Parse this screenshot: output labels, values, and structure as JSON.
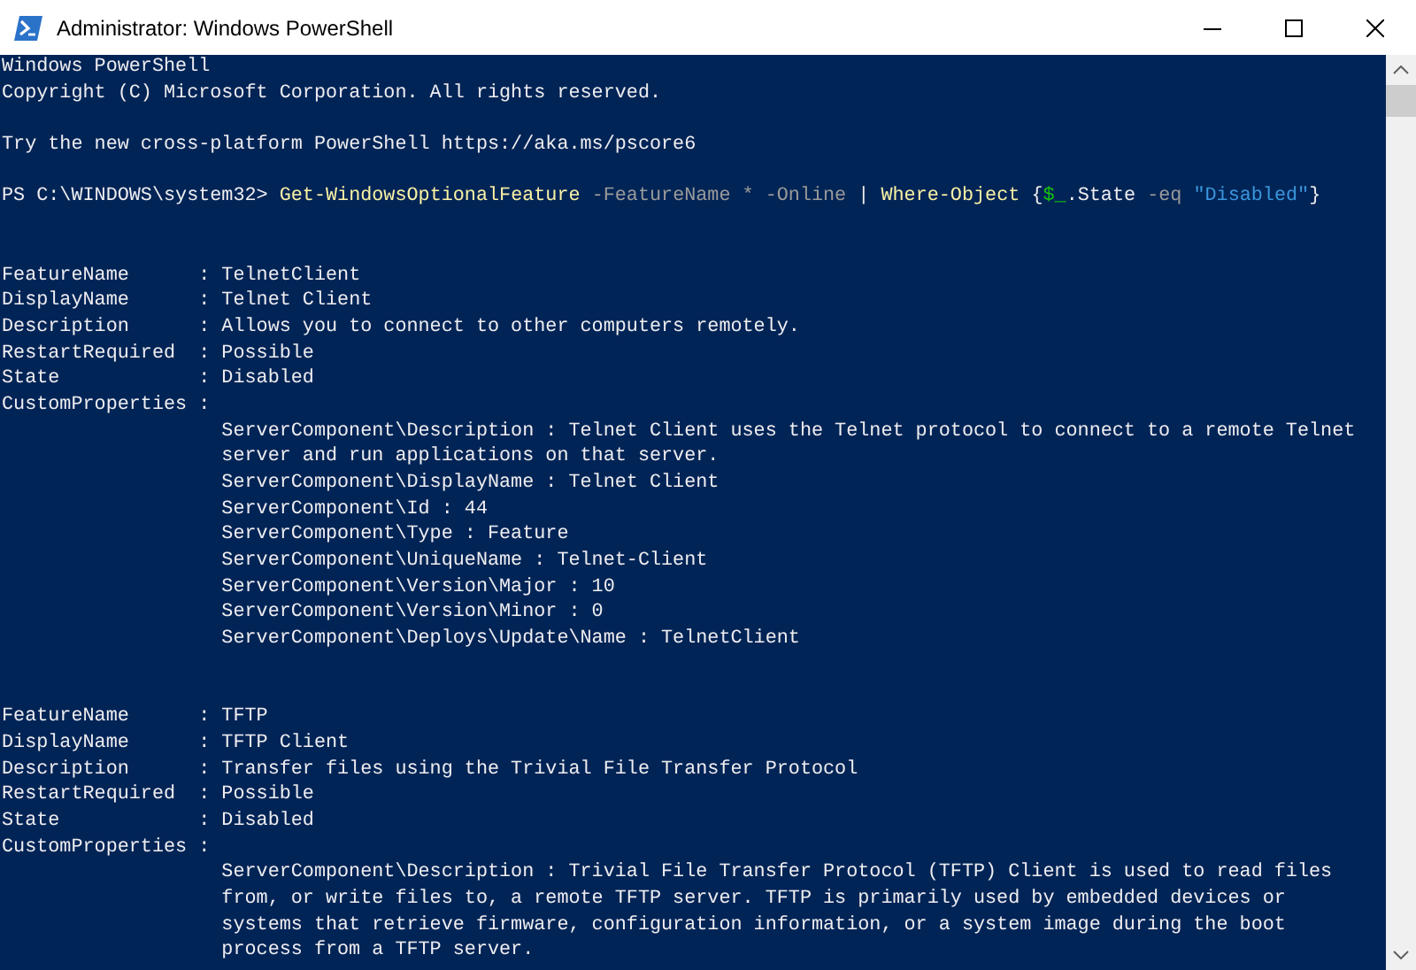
{
  "window": {
    "title": "Administrator: Windows PowerShell"
  },
  "console": {
    "lines": [
      {
        "kind": "output",
        "indent": false,
        "segments": [
          {
            "kind": "text",
            "text": "Windows PowerShell"
          }
        ]
      },
      {
        "kind": "output",
        "indent": false,
        "segments": [
          {
            "kind": "text",
            "text": "Copyright (C) Microsoft Corporation. All rights reserved."
          }
        ]
      },
      {
        "kind": "blank"
      },
      {
        "kind": "output",
        "indent": false,
        "segments": [
          {
            "kind": "text",
            "text": "Try the new cross-platform PowerShell https://aka.ms/pscore6"
          }
        ]
      },
      {
        "kind": "blank"
      },
      {
        "kind": "output",
        "indent": false,
        "segments": [
          {
            "kind": "text",
            "text": "PS C:\\WINDOWS\\system32> "
          },
          {
            "kind": "command",
            "text": "Get-WindowsOptionalFeature"
          },
          {
            "kind": "param",
            "text": " -FeatureName * -Online "
          },
          {
            "kind": "text",
            "text": "| "
          },
          {
            "kind": "command",
            "text": "Where-Object"
          },
          {
            "kind": "text",
            "text": " {"
          },
          {
            "kind": "variable",
            "text": "$_"
          },
          {
            "kind": "text",
            "text": ".State "
          },
          {
            "kind": "param",
            "text": "-eq "
          },
          {
            "kind": "string",
            "text": "\"Disabled\""
          },
          {
            "kind": "text",
            "text": "}"
          }
        ]
      },
      {
        "kind": "blank"
      },
      {
        "kind": "blank"
      },
      {
        "kind": "output",
        "indent": false,
        "segments": [
          {
            "kind": "text",
            "text": "FeatureName      : TelnetClient"
          }
        ]
      },
      {
        "kind": "output",
        "indent": false,
        "segments": [
          {
            "kind": "text",
            "text": "DisplayName      : Telnet Client"
          }
        ]
      },
      {
        "kind": "output",
        "indent": false,
        "segments": [
          {
            "kind": "text",
            "text": "Description      : Allows you to connect to other computers remotely."
          }
        ]
      },
      {
        "kind": "output",
        "indent": false,
        "segments": [
          {
            "kind": "text",
            "text": "RestartRequired  : Possible"
          }
        ]
      },
      {
        "kind": "output",
        "indent": false,
        "segments": [
          {
            "kind": "text",
            "text": "State            : Disabled"
          }
        ]
      },
      {
        "kind": "output",
        "indent": false,
        "segments": [
          {
            "kind": "text",
            "text": "CustomProperties :"
          }
        ]
      },
      {
        "kind": "output",
        "indent": true,
        "segments": [
          {
            "kind": "text",
            "text": "ServerComponent\\Description : Telnet Client uses the Telnet protocol to connect to a remote Telnet"
          }
        ]
      },
      {
        "kind": "output",
        "indent": true,
        "segments": [
          {
            "kind": "text",
            "text": "server and run applications on that server."
          }
        ]
      },
      {
        "kind": "output",
        "indent": true,
        "segments": [
          {
            "kind": "text",
            "text": "ServerComponent\\DisplayName : Telnet Client"
          }
        ]
      },
      {
        "kind": "output",
        "indent": true,
        "segments": [
          {
            "kind": "text",
            "text": "ServerComponent\\Id : 44"
          }
        ]
      },
      {
        "kind": "output",
        "indent": true,
        "segments": [
          {
            "kind": "text",
            "text": "ServerComponent\\Type : Feature"
          }
        ]
      },
      {
        "kind": "output",
        "indent": true,
        "segments": [
          {
            "kind": "text",
            "text": "ServerComponent\\UniqueName : Telnet-Client"
          }
        ]
      },
      {
        "kind": "output",
        "indent": true,
        "segments": [
          {
            "kind": "text",
            "text": "ServerComponent\\Version\\Major : 10"
          }
        ]
      },
      {
        "kind": "output",
        "indent": true,
        "segments": [
          {
            "kind": "text",
            "text": "ServerComponent\\Version\\Minor : 0"
          }
        ]
      },
      {
        "kind": "output",
        "indent": true,
        "segments": [
          {
            "kind": "text",
            "text": "ServerComponent\\Deploys\\Update\\Name : TelnetClient"
          }
        ]
      },
      {
        "kind": "blank"
      },
      {
        "kind": "blank"
      },
      {
        "kind": "output",
        "indent": false,
        "segments": [
          {
            "kind": "text",
            "text": "FeatureName      : TFTP"
          }
        ]
      },
      {
        "kind": "output",
        "indent": false,
        "segments": [
          {
            "kind": "text",
            "text": "DisplayName      : TFTP Client"
          }
        ]
      },
      {
        "kind": "output",
        "indent": false,
        "segments": [
          {
            "kind": "text",
            "text": "Description      : Transfer files using the Trivial File Transfer Protocol"
          }
        ]
      },
      {
        "kind": "output",
        "indent": false,
        "segments": [
          {
            "kind": "text",
            "text": "RestartRequired  : Possible"
          }
        ]
      },
      {
        "kind": "output",
        "indent": false,
        "segments": [
          {
            "kind": "text",
            "text": "State            : Disabled"
          }
        ]
      },
      {
        "kind": "output",
        "indent": false,
        "segments": [
          {
            "kind": "text",
            "text": "CustomProperties :"
          }
        ]
      },
      {
        "kind": "output",
        "indent": true,
        "segments": [
          {
            "kind": "text",
            "text": "ServerComponent\\Description : Trivial File Transfer Protocol (TFTP) Client is used to read files"
          }
        ]
      },
      {
        "kind": "output",
        "indent": true,
        "segments": [
          {
            "kind": "text",
            "text": "from, or write files to, a remote TFTP server. TFTP is primarily used by embedded devices or"
          }
        ]
      },
      {
        "kind": "output",
        "indent": true,
        "segments": [
          {
            "kind": "text",
            "text": "systems that retrieve firmware, configuration information, or a system image during the boot"
          }
        ]
      },
      {
        "kind": "output",
        "indent": true,
        "segments": [
          {
            "kind": "text",
            "text": "process from a TFTP server."
          }
        ]
      }
    ]
  }
}
